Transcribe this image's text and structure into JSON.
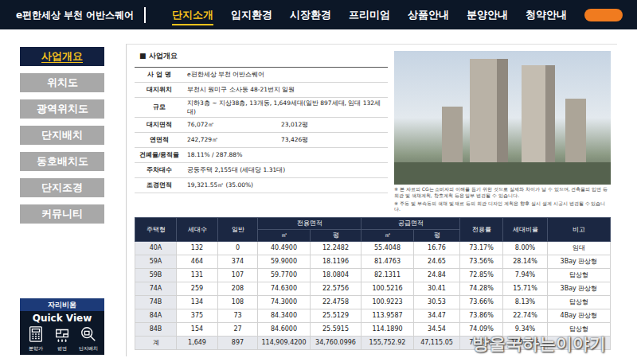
{
  "site": {
    "title": "e편한세상 부천 어반스퀘어"
  },
  "nav": [
    {
      "label": "단지소개",
      "selected": true
    },
    {
      "label": "입지환경",
      "selected": false
    },
    {
      "label": "시장환경",
      "selected": false
    },
    {
      "label": "프리미엄",
      "selected": false
    },
    {
      "label": "상품안내",
      "selected": false
    },
    {
      "label": "분양안내",
      "selected": false
    },
    {
      "label": "청약안내",
      "selected": false
    }
  ],
  "sidebar": {
    "items": [
      {
        "label": "사업개요",
        "selected": true
      },
      {
        "label": "위치도",
        "selected": false
      },
      {
        "label": "광역위치도",
        "selected": false
      },
      {
        "label": "단지배치",
        "selected": false
      },
      {
        "label": "동호배치도",
        "selected": false
      },
      {
        "label": "단지조경",
        "selected": false
      },
      {
        "label": "커뮤니티",
        "selected": false
      }
    ]
  },
  "quick_view": {
    "badge": "자리비움",
    "title": "Quick View",
    "items": [
      {
        "label": "분양가"
      },
      {
        "label": "평면"
      },
      {
        "label": "단지배치"
      }
    ]
  },
  "section_title": "■ 사업개요",
  "overview": [
    {
      "label": "사 업 명",
      "values": [
        "e편한세상 부천 어반스퀘어"
      ]
    },
    {
      "label": "대지위치",
      "values": [
        "부천시 원미구 소사동 48-21번지 일원"
      ]
    },
    {
      "label": "규모",
      "values": [
        "지하3층 ~ 지상38층, 13개동, 1,649세대(일반 897세대, 임대 132세대)"
      ]
    },
    {
      "label": "대지면적",
      "values": [
        "76,072㎡",
        "23,012평"
      ]
    },
    {
      "label": "연면적",
      "values": [
        "242,729㎡",
        "73,426평"
      ]
    },
    {
      "label": "건폐율/용적율",
      "values": [
        "18.11% / 287.88%"
      ]
    },
    {
      "label": "주차대수",
      "values": [
        "공동주택 2,155대 (세대당 1.31대)"
      ]
    },
    {
      "label": "조경면적",
      "values": [
        "19,321.55㎡ (35.00%)"
      ]
    }
  ],
  "image": {
    "notes": [
      "※ 본 자료의 CG는 소비자의 이해를 돕기 위한 것으로 실제와 차이가 날 수 있으며, 건축물의 입면 등 외관 및 색채계획, 창호계획 등은 일부 변경될 수 있습니다.",
      "※ 주동 및 부속동의 색채 및 재료 등의 외관 디자인 계획은 향후 실시 설계 시공시 변경될 수 있습니다."
    ]
  },
  "table": {
    "columns": [
      {
        "label": "주택형",
        "sub": []
      },
      {
        "label": "세대수",
        "sub": []
      },
      {
        "label": "일반",
        "sub": []
      },
      {
        "label": "전용면적",
        "sub": [
          "㎡",
          "평"
        ]
      },
      {
        "label": "공급면적",
        "sub": [
          "㎡",
          "평"
        ]
      },
      {
        "label": "전용률",
        "sub": []
      },
      {
        "label": "세대비율",
        "sub": []
      },
      {
        "label": "비고",
        "sub": []
      }
    ],
    "rows": [
      [
        "40A",
        "132",
        "0",
        "40.4900",
        "12.2482",
        "55.4048",
        "16.76",
        "73.17%",
        "8.00%",
        "임대"
      ],
      [
        "59A",
        "464",
        "374",
        "59.9000",
        "18.1196",
        "81.4763",
        "24.65",
        "73.56%",
        "28.14%",
        "3Bay 판상형"
      ],
      [
        "59B",
        "131",
        "107",
        "59.7700",
        "18.0804",
        "82.1311",
        "24.84",
        "72.85%",
        "7.94%",
        "탑상형"
      ],
      [
        "74A",
        "259",
        "208",
        "74.6300",
        "22.5756",
        "100.5216",
        "30.41",
        "74.28%",
        "15.71%",
        "3Bay 판상형"
      ],
      [
        "74B",
        "134",
        "108",
        "74.3000",
        "22.4758",
        "100.9223",
        "30.53",
        "73.66%",
        "8.13%",
        "탑상형"
      ],
      [
        "84A",
        "375",
        "73",
        "84.3400",
        "25.5129",
        "113.9587",
        "34.47",
        "73.86%",
        "22.74%",
        "4Bay 판상형"
      ],
      [
        "84B",
        "154",
        "27",
        "84.6000",
        "25.5915",
        "114.1890",
        "34.54",
        "74.09%",
        "9.34%",
        "탑상형"
      ]
    ],
    "total_row": [
      "계",
      "1,649",
      "897",
      "114,909.4200",
      "34,760.0996",
      "155,752.92",
      "47,115.05",
      "73.78%",
      "100.00%",
      ""
    ]
  },
  "watermark": "방울국하는이야기"
}
